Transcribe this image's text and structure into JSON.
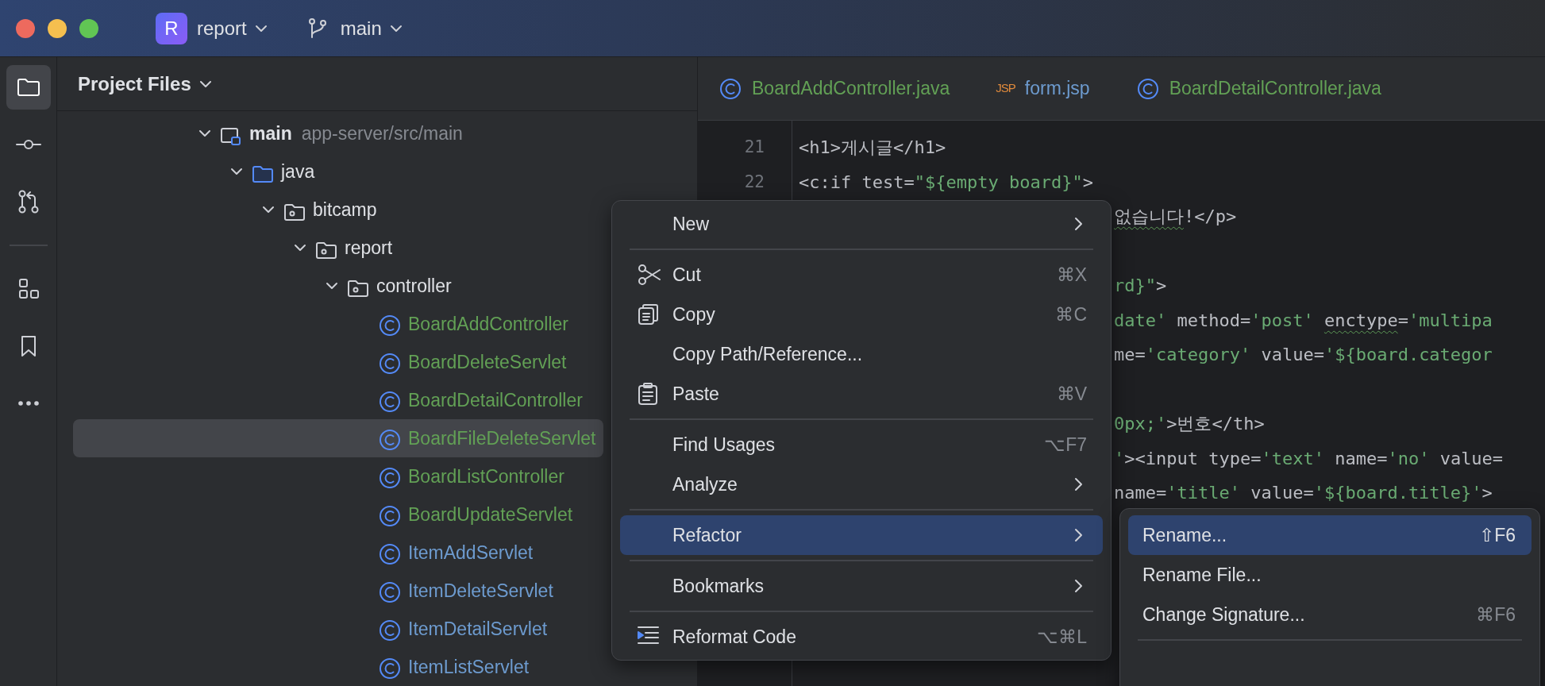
{
  "window": {
    "controls": [
      {
        "color": "#ed6a5e"
      },
      {
        "color": "#f5bf4f"
      },
      {
        "color": "#61c554"
      }
    ]
  },
  "title_bar": {
    "project": {
      "badge": "R",
      "name": "report"
    },
    "branch": {
      "name": "main"
    }
  },
  "tool_strip": [
    {
      "kind": "project",
      "selected": true
    },
    {
      "kind": "commit",
      "selected": false
    },
    {
      "kind": "pull-requests",
      "selected": false
    },
    {
      "kind": "divider"
    },
    {
      "kind": "structure",
      "selected": false
    },
    {
      "kind": "bookmarks",
      "selected": false
    },
    {
      "kind": "more",
      "selected": false
    }
  ],
  "project_panel": {
    "title": "Project Files",
    "tree": [
      {
        "label": "main",
        "path": "app-server/src/main",
        "kind": "module",
        "expanded": true,
        "selected": false,
        "children": [
          {
            "label": "java",
            "kind": "source-folder",
            "expanded": true,
            "selected": false,
            "children": [
              {
                "label": "bitcamp",
                "kind": "package",
                "expanded": true,
                "selected": false,
                "children": [
                  {
                    "label": "report",
                    "kind": "package",
                    "expanded": true,
                    "selected": false,
                    "children": [
                      {
                        "label": "controller",
                        "kind": "package",
                        "expanded": true,
                        "selected": false,
                        "children": [
                          {
                            "label": "BoardAddController",
                            "kind": "class",
                            "color": "#62a055",
                            "selected": false
                          },
                          {
                            "label": "BoardDeleteServlet",
                            "kind": "class",
                            "color": "#62a055",
                            "selected": false
                          },
                          {
                            "label": "BoardDetailController",
                            "kind": "class",
                            "color": "#62a055",
                            "selected": false
                          },
                          {
                            "label": "BoardFileDeleteServlet",
                            "kind": "class",
                            "color": "#62a055",
                            "selected": true
                          },
                          {
                            "label": "BoardListController",
                            "kind": "class",
                            "color": "#62a055",
                            "selected": false
                          },
                          {
                            "label": "BoardUpdateServlet",
                            "kind": "class",
                            "color": "#62a055",
                            "selected": false
                          },
                          {
                            "label": "ItemAddServlet",
                            "kind": "class",
                            "color": "#6d9bcf",
                            "selected": false
                          },
                          {
                            "label": "ItemDeleteServlet",
                            "kind": "class",
                            "color": "#6d9bcf",
                            "selected": false
                          },
                          {
                            "label": "ItemDetailServlet",
                            "kind": "class",
                            "color": "#6d9bcf",
                            "selected": false
                          },
                          {
                            "label": "ItemListServlet",
                            "kind": "class",
                            "color": "#6d9bcf",
                            "selected": false
                          }
                        ]
                      }
                    ]
                  }
                ]
              }
            ]
          }
        ]
      }
    ]
  },
  "editor": {
    "tabs": [
      {
        "label": "BoardAddController.java",
        "kind": "class",
        "color": "#62a055"
      },
      {
        "label": "form.jsp",
        "kind": "jsp",
        "badge": "JSP",
        "color": "#6d9bcf"
      },
      {
        "label": "BoardDetailController.java",
        "kind": "class",
        "color": "#62a055"
      }
    ],
    "lines": [
      {
        "kind": "full",
        "number": "21",
        "tokens": [
          {
            "kind": "plain",
            "text": "<h1>게시글</h1>"
          }
        ]
      },
      {
        "kind": "full",
        "number": "22",
        "tokens": [
          {
            "kind": "plain",
            "text": "<c:if test="
          },
          {
            "kind": "str",
            "text": "\"${empty board}\""
          },
          {
            "kind": "plain",
            "text": ">"
          }
        ]
      },
      {
        "kind": "partial",
        "tokens": [
          {
            "kind": "warn",
            "text": "없습니다"
          },
          {
            "kind": "plain",
            "text": "!</p>"
          }
        ]
      },
      {
        "kind": "blank"
      },
      {
        "kind": "partial",
        "tokens": [
          {
            "kind": "str",
            "text": "rd}\""
          },
          {
            "kind": "plain",
            "text": ">"
          }
        ]
      },
      {
        "kind": "partial",
        "tokens": [
          {
            "kind": "str",
            "text": "date'"
          },
          {
            "kind": "plain",
            "text": " method="
          },
          {
            "kind": "str",
            "text": "'post' "
          },
          {
            "kind": "warn",
            "text": "enctype"
          },
          {
            "kind": "plain",
            "text": "="
          },
          {
            "kind": "str",
            "text": "'multipa"
          }
        ]
      },
      {
        "kind": "partial",
        "tokens": [
          {
            "kind": "plain",
            "text": "me="
          },
          {
            "kind": "str",
            "text": "'category'"
          },
          {
            "kind": "plain",
            "text": " value="
          },
          {
            "kind": "str",
            "text": "'${board.categor"
          }
        ]
      },
      {
        "kind": "blank"
      },
      {
        "kind": "partial",
        "tokens": [
          {
            "kind": "str",
            "text": "0px;'"
          },
          {
            "kind": "plain",
            "text": ">번호</th>"
          }
        ]
      },
      {
        "kind": "partial",
        "tokens": [
          {
            "kind": "str",
            "text": "'"
          },
          {
            "kind": "plain",
            "text": "><input type="
          },
          {
            "kind": "str",
            "text": "'text'"
          },
          {
            "kind": "plain",
            "text": " name="
          },
          {
            "kind": "str",
            "text": "'no'"
          },
          {
            "kind": "plain",
            "text": " value="
          }
        ]
      },
      {
        "kind": "partial",
        "tokens": [
          {
            "kind": "plain",
            "text": "name="
          },
          {
            "kind": "str",
            "text": "'title'"
          },
          {
            "kind": "plain",
            "text": " value="
          },
          {
            "kind": "str",
            "text": "'${board.title}'"
          },
          {
            "kind": "plain",
            "text": ">"
          }
        ]
      }
    ]
  },
  "context_menu": [
    {
      "kind": "submenu",
      "label": "New",
      "selected": false
    },
    {
      "kind": "separator"
    },
    {
      "kind": "cut",
      "label": "Cut",
      "shortcut": "⌘X",
      "selected": false
    },
    {
      "kind": "copy",
      "label": "Copy",
      "shortcut": "⌘C",
      "selected": false
    },
    {
      "kind": "plain",
      "label": "Copy Path/Reference...",
      "selected": false
    },
    {
      "kind": "paste",
      "label": "Paste",
      "shortcut": "⌘V",
      "selected": false
    },
    {
      "kind": "separator"
    },
    {
      "kind": "plain",
      "label": "Find Usages",
      "shortcut": "⌥F7",
      "selected": false
    },
    {
      "kind": "submenu",
      "label": "Analyze",
      "selected": false
    },
    {
      "kind": "separator"
    },
    {
      "kind": "submenu",
      "label": "Refactor",
      "selected": true,
      "children": [
        {
          "kind": "plain",
          "label": "Rename...",
          "shortcut": "⇧F6",
          "selected": true
        },
        {
          "kind": "plain",
          "label": "Rename File...",
          "selected": false
        },
        {
          "kind": "plain",
          "label": "Change Signature...",
          "shortcut": "⌘F6",
          "selected": false
        },
        {
          "kind": "separator"
        }
      ]
    },
    {
      "kind": "separator"
    },
    {
      "kind": "submenu",
      "label": "Bookmarks",
      "selected": false
    },
    {
      "kind": "separator"
    },
    {
      "kind": "reformat",
      "label": "Reformat Code",
      "shortcut": "⌥⌘L",
      "selected": false
    }
  ]
}
